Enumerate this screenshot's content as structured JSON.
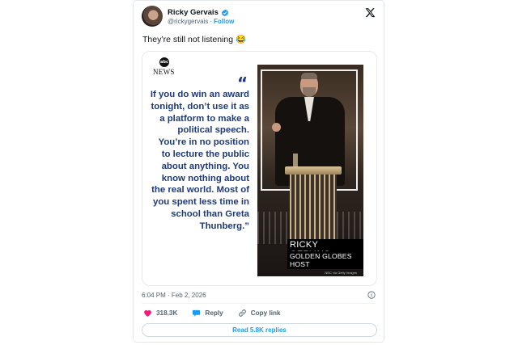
{
  "user": {
    "name": "Ricky Gervais",
    "handle": "@rickygervais",
    "separator": "·",
    "follow_label": "Follow"
  },
  "tweet": {
    "text": "They’re still not listening 😂",
    "timestamp": "6:04 PM · Feb 2, 2026"
  },
  "media": {
    "logo_text": "abc",
    "network": "NEWS",
    "quote_mark": "“",
    "quote": "If you do win an award tonight, don’t use it as a platform to make a political speech. You’re in no position to lecture the public about anything. You know nothing about the real world. Most of you spent less time in school than Greta Thunberg.”",
    "caption_name": "RICKY GERVAIS",
    "caption_title": "GOLDEN GLOBES HOST",
    "credit": "NBC via Getty Images"
  },
  "actions": {
    "likes": "318.3K",
    "reply_label": "Reply",
    "copy_label": "Copy link"
  },
  "replies_button": "Read 5.8K replies",
  "colors": {
    "accent": "#1d9bf0",
    "like": "#f91880",
    "quote_text": "#1e3a78"
  }
}
